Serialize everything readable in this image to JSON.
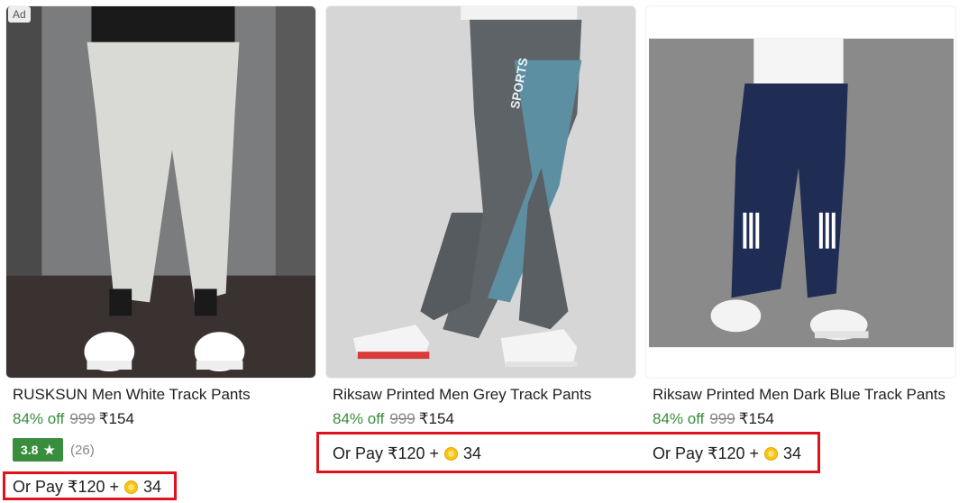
{
  "products": [
    {
      "id_label": "card-1",
      "ad_badge": "Ad",
      "title": "RUSKSUN Men White Track Pants",
      "discount": "84% off",
      "mrp": "999",
      "price": "₹154",
      "rating": "3.8",
      "rating_star": "★",
      "rating_count": "(26)",
      "or_pay_prefix": "Or Pay ₹120 +",
      "or_pay_coins": "34",
      "image_icon": "white-track-pants-image"
    },
    {
      "id_label": "card-2",
      "title": "Riksaw Printed Men Grey Track Pants",
      "discount": "84% off",
      "mrp": "999",
      "price": "₹154",
      "or_pay_prefix": "Or Pay ₹120 +",
      "or_pay_coins": "34",
      "image_icon": "grey-track-pants-image",
      "print_text": "SPORTS"
    },
    {
      "id_label": "card-3",
      "title": "Riksaw Printed Men Dark Blue Track Pants",
      "discount": "84% off",
      "mrp": "999",
      "price": "₹154",
      "or_pay_prefix": "Or Pay ₹120 +",
      "or_pay_coins": "34",
      "image_icon": "dark-blue-track-pants-image"
    }
  ],
  "colors": {
    "discount_green": "#388e3c",
    "rating_badge_green": "#388e3c",
    "mrp_grey": "#878787",
    "highlight_red": "#e0121b",
    "coin_gold": "#f5c518"
  }
}
